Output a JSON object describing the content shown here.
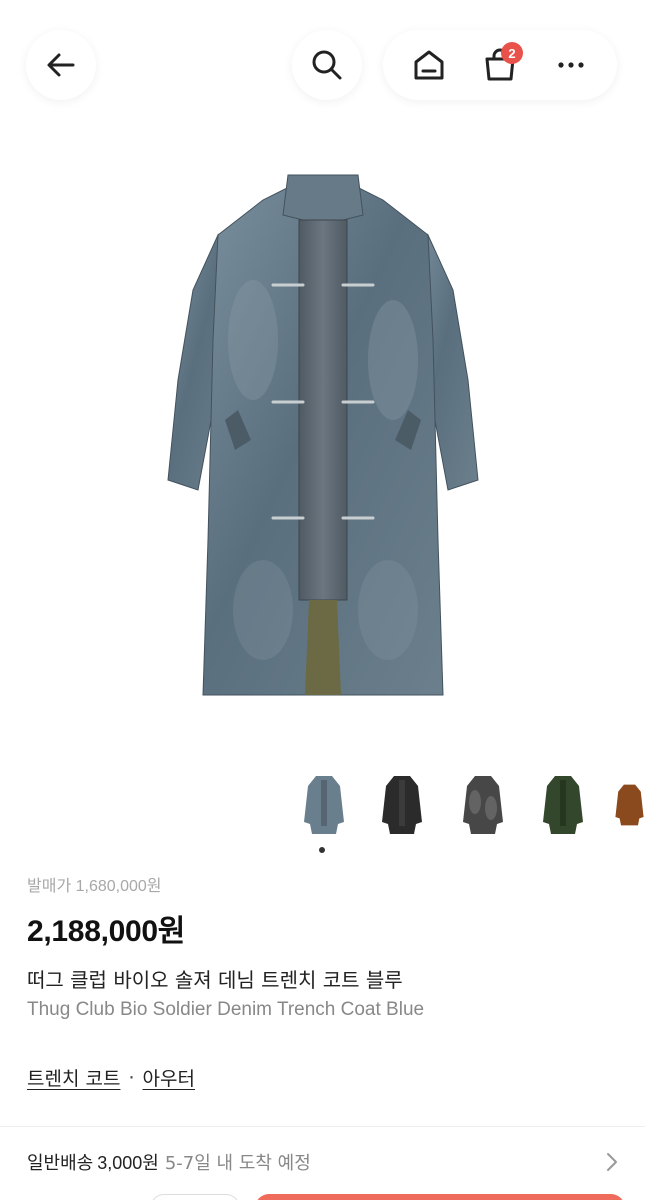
{
  "header": {
    "cart_count": "2",
    "icons": [
      "back-arrow-icon",
      "search-icon",
      "home-icon",
      "shopping-bag-icon",
      "more-dots-icon"
    ]
  },
  "thumbnails": [
    {
      "name": "blue-denim"
    },
    {
      "name": "black"
    },
    {
      "name": "black-grey"
    },
    {
      "name": "olive-green"
    },
    {
      "name": "brown"
    }
  ],
  "product": {
    "list_price": "발매가 1,680,000원",
    "sale_price": "2,188,000원",
    "title_ko": "떠그 클럽 바이오 솔져 데님 트렌치 코트 블루",
    "title_en": "Thug Club Bio Soldier Denim Trench Coat Blue"
  },
  "categories": {
    "primary": "트렌치 코트",
    "separator": "·",
    "secondary": "아우터"
  },
  "shipping": {
    "label": "일반배송",
    "fee": "3,000원",
    "eta": "5-7일 내 도착 예정"
  },
  "colors": {
    "accent": "#ef6c5c",
    "badge": "#e8524a",
    "denim": "#5f7585"
  }
}
